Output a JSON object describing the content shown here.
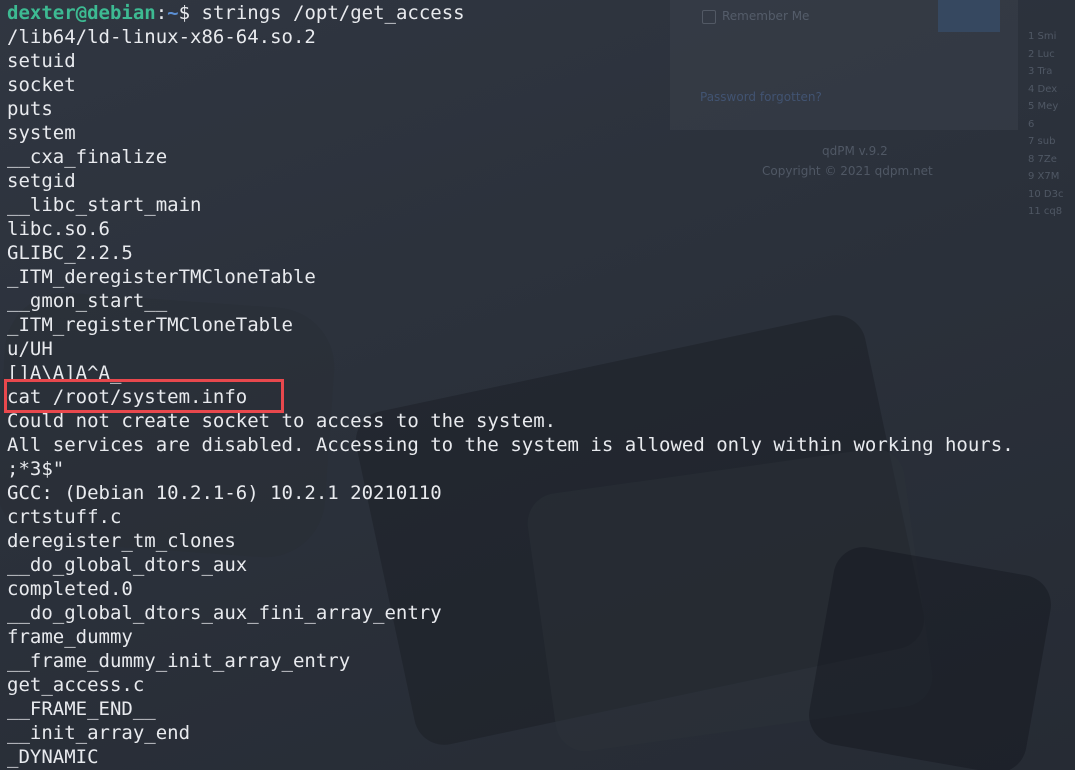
{
  "background": {
    "remember_me": "Remember Me",
    "password_forgotten": "Password forgotten?",
    "version": "qdPM v.9.2",
    "copyright": "Copyright © 2021 qdpm.net",
    "user_list": [
      "1 Smi",
      "2 Luc",
      "3 Tra",
      "4 Dex",
      "5 Mey",
      "6",
      "7 sub",
      "8 7Ze",
      "9 X7M",
      "10 D3c",
      "11 cq8"
    ]
  },
  "terminal": {
    "prompt": {
      "user_host": "dexter@debian",
      "separator": ":",
      "path": "~",
      "symbol": "$ ",
      "command": "strings /opt/get_access"
    },
    "highlight_color": "#e8484d",
    "lines": [
      "/lib64/ld-linux-x86-64.so.2",
      "setuid",
      "socket",
      "puts",
      "system",
      "__cxa_finalize",
      "setgid",
      "__libc_start_main",
      "libc.so.6",
      "GLIBC_2.2.5",
      "_ITM_deregisterTMCloneTable",
      "__gmon_start__",
      "_ITM_registerTMCloneTable",
      "u/UH",
      "[]A\\A]A^A_",
      "cat /root/system.info",
      "Could not create socket to access to the system.",
      "All services are disabled. Accessing to the system is allowed only within working hours.",
      ";*3$\"",
      "GCC: (Debian 10.2.1-6) 10.2.1 20210110",
      "crtstuff.c",
      "deregister_tm_clones",
      "__do_global_dtors_aux",
      "completed.0",
      "__do_global_dtors_aux_fini_array_entry",
      "frame_dummy",
      "__frame_dummy_init_array_entry",
      "get_access.c",
      "__FRAME_END__",
      "__init_array_end",
      "_DYNAMIC"
    ]
  }
}
